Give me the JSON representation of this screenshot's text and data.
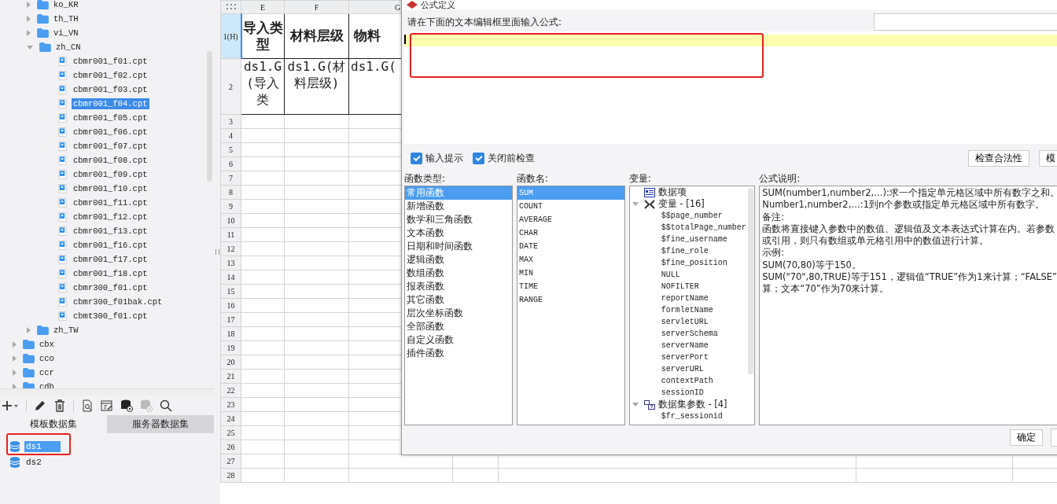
{
  "tree": {
    "nested_folders": [
      {
        "label": "ko_KR",
        "expanded": false
      },
      {
        "label": "th_TH",
        "expanded": false
      },
      {
        "label": "vi_VN",
        "expanded": false
      },
      {
        "label": "zh_CN",
        "expanded": true,
        "children": [
          {
            "label": "cbmr001_f01.cpt",
            "selected": false
          },
          {
            "label": "cbmr001_f02.cpt",
            "selected": false
          },
          {
            "label": "cbmr001_f03.cpt",
            "selected": false
          },
          {
            "label": "cbmr001_f04.cpt",
            "selected": true
          },
          {
            "label": "cbmr001_f05.cpt",
            "selected": false
          },
          {
            "label": "cbmr001_f06.cpt",
            "selected": false
          },
          {
            "label": "cbmr001_f07.cpt",
            "selected": false
          },
          {
            "label": "cbmr001_f08.cpt",
            "selected": false
          },
          {
            "label": "cbmr001_f09.cpt",
            "selected": false
          },
          {
            "label": "cbmr001_f10.cpt",
            "selected": false
          },
          {
            "label": "cbmr001_f11.cpt",
            "selected": false
          },
          {
            "label": "cbmr001_f12.cpt",
            "selected": false
          },
          {
            "label": "cbmr001_f13.cpt",
            "selected": false
          },
          {
            "label": "cbmr001_f16.cpt",
            "selected": false
          },
          {
            "label": "cbmr001_f17.cpt",
            "selected": false
          },
          {
            "label": "cbmr001_f18.cpt",
            "selected": false
          },
          {
            "label": "cbmr300_f01.cpt",
            "selected": false
          },
          {
            "label": "cbmr300_f01bak.cpt",
            "selected": false
          },
          {
            "label": "cbmt300_f01.cpt",
            "selected": false
          }
        ]
      },
      {
        "label": "zh_TW",
        "expanded": false
      }
    ],
    "folders": [
      {
        "label": "cbx",
        "expanded": false
      },
      {
        "label": "cco",
        "expanded": false
      },
      {
        "label": "ccr",
        "expanded": false
      },
      {
        "label": "cdb",
        "expanded": false
      }
    ]
  },
  "dataset_tabs": [
    {
      "label": "模板数据集",
      "selected": true
    },
    {
      "label": "服务器数据集",
      "selected": false
    }
  ],
  "datasets": [
    {
      "label": "ds1",
      "selected": true
    },
    {
      "label": "ds2",
      "selected": false
    }
  ],
  "sheet": {
    "columns": [
      "E",
      "F",
      "G"
    ],
    "row_headers": [
      {
        "label": "1(H)",
        "selected": true
      },
      {
        "label": "2",
        "selected": false
      },
      {
        "label": "3",
        "selected": false
      },
      {
        "label": "4",
        "selected": false
      },
      {
        "label": "5",
        "selected": false
      },
      {
        "label": "6",
        "selected": false
      },
      {
        "label": "7",
        "selected": false
      },
      {
        "label": "8",
        "selected": false
      },
      {
        "label": "9",
        "selected": false
      },
      {
        "label": "10",
        "selected": false
      },
      {
        "label": "11",
        "selected": false
      },
      {
        "label": "12",
        "selected": false
      },
      {
        "label": "13",
        "selected": false
      },
      {
        "label": "14",
        "selected": false
      },
      {
        "label": "15",
        "selected": false
      },
      {
        "label": "16",
        "selected": false
      },
      {
        "label": "17",
        "selected": false
      },
      {
        "label": "18",
        "selected": false
      },
      {
        "label": "19",
        "selected": false
      },
      {
        "label": "20",
        "selected": false
      },
      {
        "label": "21",
        "selected": false
      },
      {
        "label": "22",
        "selected": false
      },
      {
        "label": "23",
        "selected": false
      },
      {
        "label": "24",
        "selected": false
      },
      {
        "label": "25",
        "selected": false
      },
      {
        "label": "26",
        "selected": false
      },
      {
        "label": "27",
        "selected": false
      },
      {
        "label": "28",
        "selected": false
      }
    ],
    "header_row": [
      "导入类型",
      "材料层级",
      "物料"
    ],
    "data_row": [
      "ds1.G(导入类",
      "ds1.G(材料层级)",
      "ds1.G("
    ]
  },
  "dialog": {
    "title": "公式定义",
    "prompt": "请在下面的文本编辑框里面输入公式:",
    "options": [
      {
        "label": "输入提示",
        "checked": true
      },
      {
        "label": "关闭前检查",
        "checked": true
      }
    ],
    "buttons": [
      "检查合法性",
      "模"
    ],
    "function_types": {
      "label": "函数类型:",
      "items": [
        {
          "label": "常用函数",
          "selected": true
        },
        {
          "label": "新增函数",
          "selected": false
        },
        {
          "label": "数学和三角函数",
          "selected": false
        },
        {
          "label": "文本函数",
          "selected": false
        },
        {
          "label": "日期和时间函数",
          "selected": false
        },
        {
          "label": "逻辑函数",
          "selected": false
        },
        {
          "label": "数组函数",
          "selected": false
        },
        {
          "label": "报表函数",
          "selected": false
        },
        {
          "label": "其它函数",
          "selected": false
        },
        {
          "label": "层次坐标函数",
          "selected": false
        },
        {
          "label": "全部函数",
          "selected": false
        },
        {
          "label": "自定义函数",
          "selected": false
        },
        {
          "label": "插件函数",
          "selected": false
        }
      ]
    },
    "function_names": {
      "label": "函数名:",
      "items": [
        {
          "label": "SUM",
          "selected": true
        },
        {
          "label": "COUNT",
          "selected": false
        },
        {
          "label": "AVERAGE",
          "selected": false
        },
        {
          "label": "CHAR",
          "selected": false
        },
        {
          "label": "DATE",
          "selected": false
        },
        {
          "label": "MAX",
          "selected": false
        },
        {
          "label": "MIN",
          "selected": false
        },
        {
          "label": "TIME",
          "selected": false
        },
        {
          "label": "RANGE",
          "selected": false
        }
      ]
    },
    "variables": {
      "label": "变量:",
      "nodes": [
        {
          "kind": "data_item",
          "label": "数据项"
        },
        {
          "kind": "variables",
          "label": "变量 - [16]",
          "expanded": true,
          "children": [
            "$$page_number",
            "$$totalPage_number",
            "$fine_username",
            "$fine_role",
            "$fine_position",
            "NULL",
            "NOFILTER",
            "reportName",
            "formletName",
            "servletURL",
            "serverSchema",
            "serverName",
            "serverPort",
            "serverURL",
            "contextPath",
            "sessionID"
          ]
        },
        {
          "kind": "dataset_params",
          "label": "数据集参数 - [4]",
          "expanded": true,
          "children": [
            "$fr_sessionid"
          ]
        }
      ]
    },
    "description": {
      "label": "公式说明:",
      "lines": [
        "SUM(number1,number2,…):求一个指定单元格区域中所有数字之和。",
        "Number1,number2,…:1到n个参数或指定单元格区域中所有数字。",
        "备注:",
        "函数将直接键入参数中的数值、逻辑值及文本表达式计算在内。若参数",
        "或引用，则只有数组或单元格引用中的数值进行计算。",
        "示例:",
        "SUM(70,80)等于150。",
        "SUM(\"70\",80,TRUE)等于151，逻辑值“TRUE”作为1来计算；“FALSE”",
        "算；文本“70”作为70来计算。"
      ]
    },
    "ok_button": "确定"
  }
}
